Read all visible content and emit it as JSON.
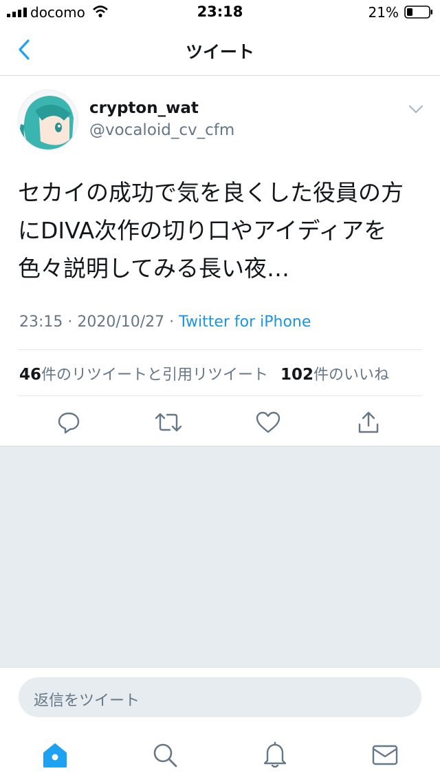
{
  "status_bar": {
    "carrier": "docomo",
    "time": "23:18",
    "battery": "21%"
  },
  "nav": {
    "title": "ツイート"
  },
  "tweet": {
    "name": "crypton_wat",
    "handle": "@vocaloid_cv_cfm",
    "text": "セカイの成功で気を良くした役員の方にDIVA次作の切り口やアイディアを色々説明してみる長い夜…",
    "datetime": "23:15 · 2020/10/27 · ",
    "source": "Twitter for iPhone"
  },
  "stats": {
    "retweet_count": "46",
    "retweet_label": "件のリツイートと引用リツイート",
    "like_count": "102",
    "like_label": "件のいいね"
  },
  "reply": {
    "placeholder": "返信をツイート"
  },
  "colors": {
    "accent": "#1da1f2",
    "text": "#14171a",
    "secondary": "#657786",
    "divider": "#e1e8ed",
    "background_gray": "#e6ecf0"
  },
  "icons": [
    "signal-icon",
    "wifi-icon",
    "battery-icon",
    "back-chevron-icon",
    "chevron-down-icon",
    "reply-icon",
    "retweet-icon",
    "like-icon",
    "share-icon",
    "home-icon",
    "search-icon",
    "notifications-icon",
    "messages-icon"
  ]
}
